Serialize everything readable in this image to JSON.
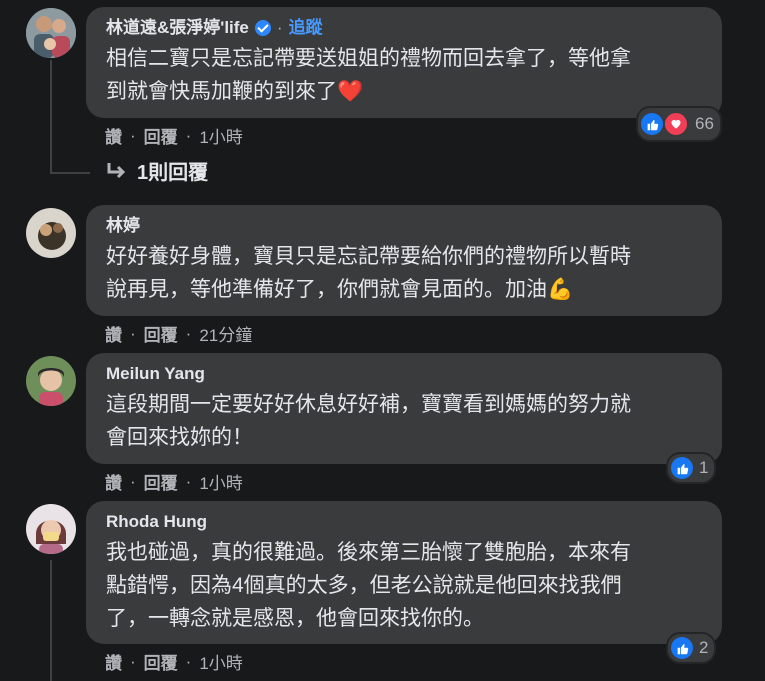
{
  "comments": [
    {
      "author": "林道遠&張淨婷'life",
      "verified": true,
      "separator": "·",
      "follow_label": "追蹤",
      "text": "相信二寶只是忘記帶要送姐姐的禮物而回去拿了，等他拿\n到就會快馬加鞭的到來了",
      "text_emoji": "❤️",
      "like_label": "讚",
      "reply_label": "回覆",
      "time": "1小時",
      "reactions": [
        "like",
        "love"
      ],
      "reaction_count": "66",
      "replies_label": "1則回覆"
    },
    {
      "author": "林婷",
      "text": "好好養好身體，寶貝只是忘記帶要給你們的禮物所以暫時\n說再見，等他準備好了，你們就會見面的。加油",
      "text_emoji": "💪",
      "like_label": "讚",
      "reply_label": "回覆",
      "time": "21分鐘"
    },
    {
      "author": "Meilun Yang",
      "text": "這段期間一定要好好休息好好補，寶寶看到媽媽的努力就\n會回來找妳的！",
      "like_label": "讚",
      "reply_label": "回覆",
      "time": "1小時",
      "reactions": [
        "like"
      ],
      "reaction_count": "1"
    },
    {
      "author": "Rhoda Hung",
      "text": "我也碰過，真的很難過。後來第三胎懷了雙胞胎，本來有\n點錯愕，因為4個真的太多，但老公說就是他回來找我們\n了，一轉念就是感恩，他會回來找你的。",
      "like_label": "讚",
      "reply_label": "回覆",
      "time": "1小時",
      "reactions": [
        "like"
      ],
      "reaction_count": "2"
    }
  ],
  "colors": {
    "background": "#18191a",
    "bubble": "#3a3b3c",
    "accent": "#4599ff",
    "like": "#1877f2",
    "love": "#f33e58"
  }
}
